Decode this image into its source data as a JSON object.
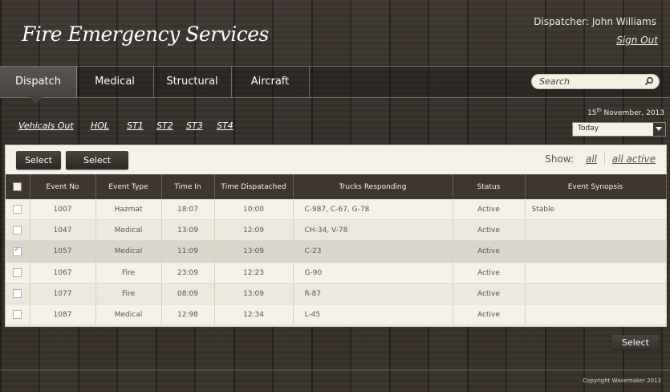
{
  "header": {
    "logo": "Fire Emergency Services",
    "dispatcher": "Dispatcher: John Williams",
    "sign_out": "Sign Out"
  },
  "nav": {
    "tabs": [
      {
        "label": "Dispatch",
        "active": true
      },
      {
        "label": "Medical",
        "active": false
      },
      {
        "label": "Structural",
        "active": false
      },
      {
        "label": "Aircraft",
        "active": false
      }
    ],
    "search_placeholder": "Search"
  },
  "filters": {
    "links": [
      "Vehicals Out",
      "HOL",
      "ST1",
      "ST2",
      "ST3",
      "ST4"
    ],
    "date_day": "15",
    "date_suffix": "th",
    "date_rest": "November, 2013",
    "period_value": "Today"
  },
  "toolbar": {
    "select_1": "Select",
    "select_2": "Select",
    "show_label": "Show:",
    "show_all": "all",
    "show_active": "all active"
  },
  "table": {
    "columns": [
      "Event No",
      "Event Type",
      "Time In",
      "Time Dispatached",
      "Trucks Responding",
      "Status",
      "Event Synopsis"
    ],
    "rows": [
      {
        "event_no": "1007",
        "type": "Hazmat",
        "time_in": "18:07",
        "dispatched": "10:00",
        "trucks": "C-987, C-67, G-78",
        "status": "Active",
        "synopsis": "Stable",
        "checked": false
      },
      {
        "event_no": "1047",
        "type": "Medical",
        "time_in": "13:09",
        "dispatched": "12:09",
        "trucks": "CH-34, V-78",
        "status": "Active",
        "synopsis": "",
        "checked": false
      },
      {
        "event_no": "1057",
        "type": "Medical",
        "time_in": "11:09",
        "dispatched": "13:09",
        "trucks": "C-23",
        "status": "Active",
        "synopsis": "",
        "checked": true
      },
      {
        "event_no": "1067",
        "type": "Fire",
        "time_in": "23:09",
        "dispatched": "12:23",
        "trucks": "G-90",
        "status": "Active",
        "synopsis": "",
        "checked": false
      },
      {
        "event_no": "1077",
        "type": "Fire",
        "time_in": "08:09",
        "dispatched": "13:09",
        "trucks": "R-87",
        "status": "Active",
        "synopsis": "",
        "checked": false
      },
      {
        "event_no": "1087",
        "type": "Medical",
        "time_in": "12:98",
        "dispatched": "12:34",
        "trucks": "L-45",
        "status": "Active",
        "synopsis": "",
        "checked": false
      }
    ]
  },
  "bottom_select": "Select",
  "footer": {
    "copyright": "Copyright Wavemaker 2013"
  },
  "colors": {
    "header_bg": "#3e3731",
    "panel_bg": "#f3f1e8",
    "selected_row": "#d9d7cc"
  }
}
